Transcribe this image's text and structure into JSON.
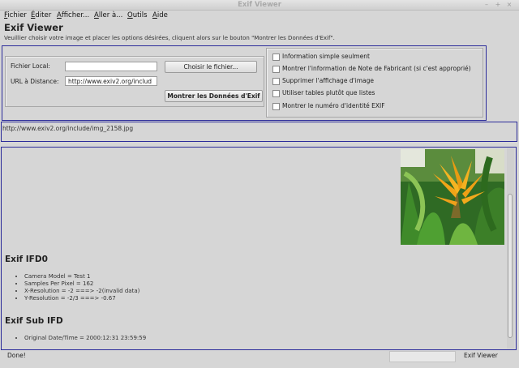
{
  "window": {
    "title": "Exif Viewer",
    "controls": [
      "–",
      "+",
      "×"
    ]
  },
  "menu": {
    "items": [
      {
        "mnemonic": "F",
        "rest": "ichier"
      },
      {
        "mnemonic": "É",
        "rest": "diter"
      },
      {
        "mnemonic": "A",
        "rest": "fficher..."
      },
      {
        "mnemonic": "A",
        "rest": "ller à..."
      },
      {
        "mnemonic": "O",
        "rest": "utils"
      },
      {
        "mnemonic": "A",
        "rest": "ide"
      }
    ]
  },
  "page": {
    "title": "Exif Viewer",
    "intro": "Veuillier choisir votre image et placer les options désirées, cliquent alors sur le bouton \"Montrer les Données d'Exif\"."
  },
  "form": {
    "local_label": "Fichier Local:",
    "local_value": "",
    "choose_button": "Choisir le fichier...",
    "url_label": "URL à Distance:",
    "url_value": "http://www.exiv2.org/includ",
    "show_button": "Montrer les Données d'Exif"
  },
  "options": [
    {
      "label": "Information simple seulment",
      "checked": false
    },
    {
      "label": "Montrer l'information de Note de Fabricant (si c'est approprié)",
      "checked": false
    },
    {
      "label": "Supprimer l'affichage d'image",
      "checked": false
    },
    {
      "label": "Utiliser tables plutôt que listes",
      "checked": false
    },
    {
      "label": "Montrer le numéro d'identité EXIF",
      "checked": false
    }
  ],
  "current_url": "http://www.exiv2.org/include/img_2158.jpg",
  "results": {
    "ifd0": {
      "heading": "Exif IFD0",
      "items": [
        "Camera Model = Test 1",
        "Samples Per Pixel = 162",
        "X-Resolution = -2 ===> -2(invalid data)",
        "Y-Resolution = -2/3 ===> -0.67"
      ]
    },
    "subifd": {
      "heading": "Exif Sub IFD",
      "items": [
        "Original Date/Time = 2000:12:31 23:59:59"
      ]
    }
  },
  "status": {
    "text": "Done!",
    "app": "Exif Viewer"
  },
  "colors": {
    "frame_blue": "#2b2b9a",
    "background": "#d6d6d6"
  }
}
